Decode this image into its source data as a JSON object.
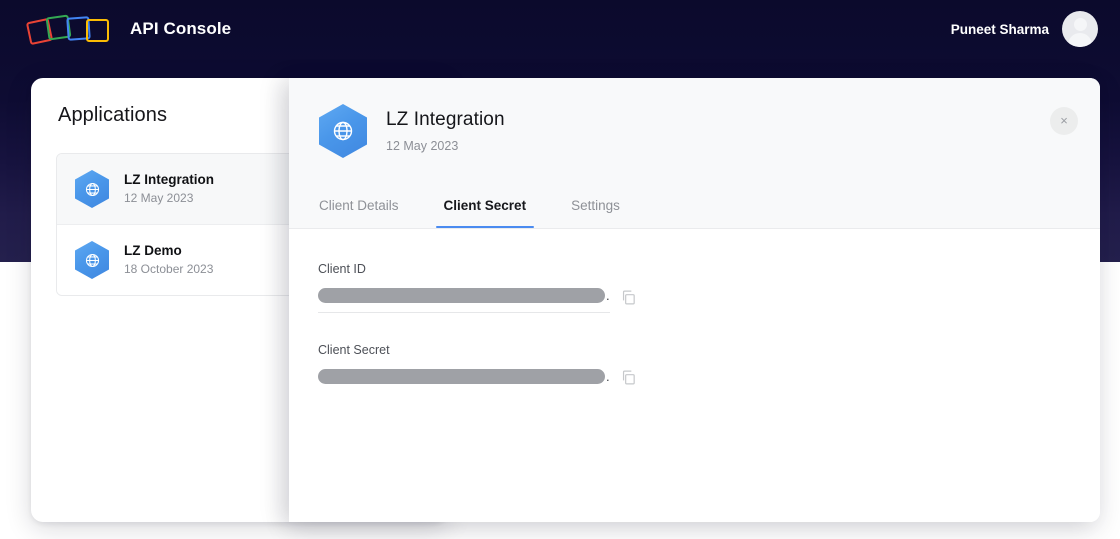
{
  "topbar": {
    "brand_title": "API Console",
    "logo_icon": "four-squares-logo",
    "user_name": "Puneet Sharma",
    "avatar_icon": "user-avatar-placeholder"
  },
  "applications_panel": {
    "heading": "Applications",
    "items": [
      {
        "name": "LZ Integration",
        "date": "12 May 2023",
        "icon": "globe-hexagon-icon",
        "selected": true
      },
      {
        "name": "LZ Demo",
        "date": "18 October 2023",
        "icon": "globe-hexagon-icon",
        "selected": false
      }
    ]
  },
  "detail_panel": {
    "app_icon": "globe-hexagon-icon",
    "title": "LZ Integration",
    "subtitle": "12 May 2023",
    "close_icon": "close-icon",
    "close_label": "×",
    "tabs": [
      {
        "label": "Client Details",
        "active": false
      },
      {
        "label": "Client Secret",
        "active": true
      },
      {
        "label": "Settings",
        "active": false
      }
    ],
    "fields": [
      {
        "label": "Client ID",
        "value": "",
        "redacted": true,
        "trailing_text": ".",
        "copy_icon": "copy-icon"
      },
      {
        "label": "Client Secret",
        "value": "",
        "redacted": true,
        "trailing_text": ".",
        "copy_icon": "copy-icon"
      }
    ]
  },
  "colors": {
    "header_dark": "#0b0a2c",
    "accent_blue": "#4a8bf0",
    "redaction_grey": "#9fa1a6",
    "logo_red": "#ea4335",
    "logo_green": "#34a853",
    "logo_blue": "#4285f4",
    "logo_yellow": "#fbbc04"
  }
}
